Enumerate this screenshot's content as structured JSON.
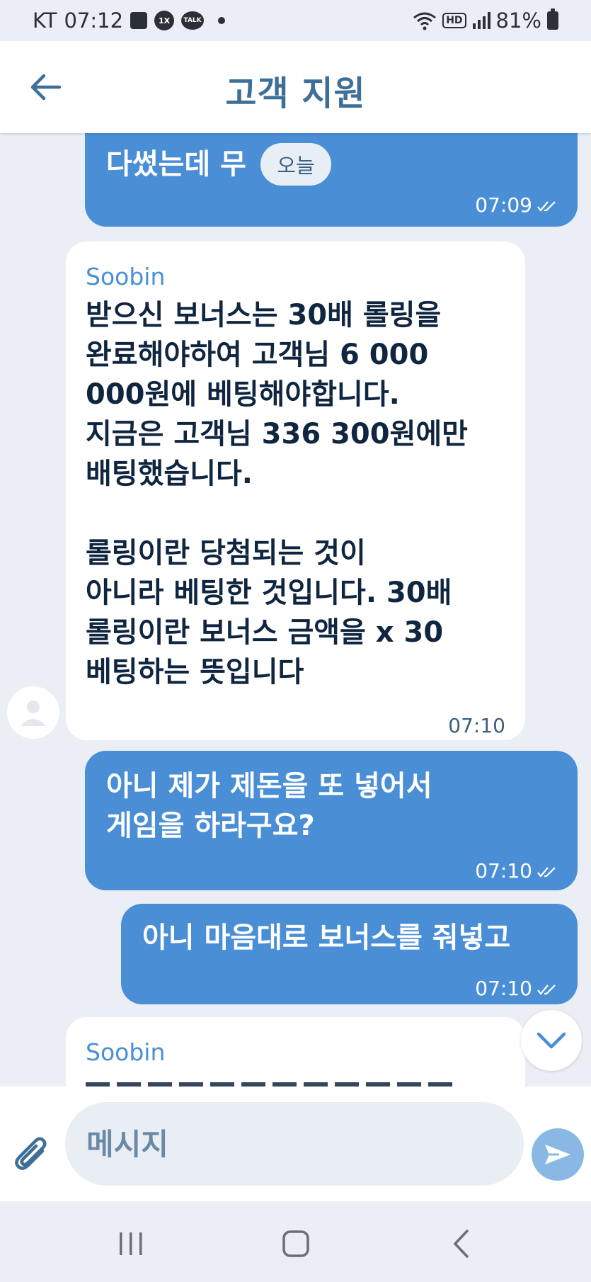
{
  "status_bar": {
    "carrier": "KT",
    "time": "07:12",
    "circle_icon_text": "1X",
    "talk_icon_text": "TALK",
    "hd_label": "HD",
    "battery": "81%"
  },
  "header": {
    "title": "고객 지원"
  },
  "chat": {
    "today_label": "오늘",
    "messages": [
      {
        "direction": "out",
        "text": "다썼는데 무",
        "time": "07:09"
      },
      {
        "direction": "in",
        "sender": "Soobin",
        "text": "받으신 보너스는 30배 롤링을\n완료해야하여 고객님 6 000\n000원에 베팅해야합니다.\n지금은 고객님 336 300원에만\n배팅했습니다.\n\n롤링이란 당첨되는 것이\n아니라 베팅한 것입니다. 30배\n롤링이란 보너스 금액을 x 30\n베팅하는 뜻입니다",
        "time": "07:10"
      },
      {
        "direction": "out",
        "text": "아니 제가 제돈을 또 넣어서\n게임을 하라구요?",
        "time": "07:10"
      },
      {
        "direction": "out",
        "text": "아니 마음대로 보너스를 줘넣고",
        "time": "07:10"
      },
      {
        "direction": "in",
        "sender": "Soobin",
        "text": "",
        "time": ""
      }
    ]
  },
  "input": {
    "placeholder": "메시지"
  },
  "colors": {
    "outgoing_bubble": "#4a8fd6",
    "incoming_bubble": "#ffffff",
    "accent": "#3e6f99",
    "background": "#ebeff5"
  }
}
